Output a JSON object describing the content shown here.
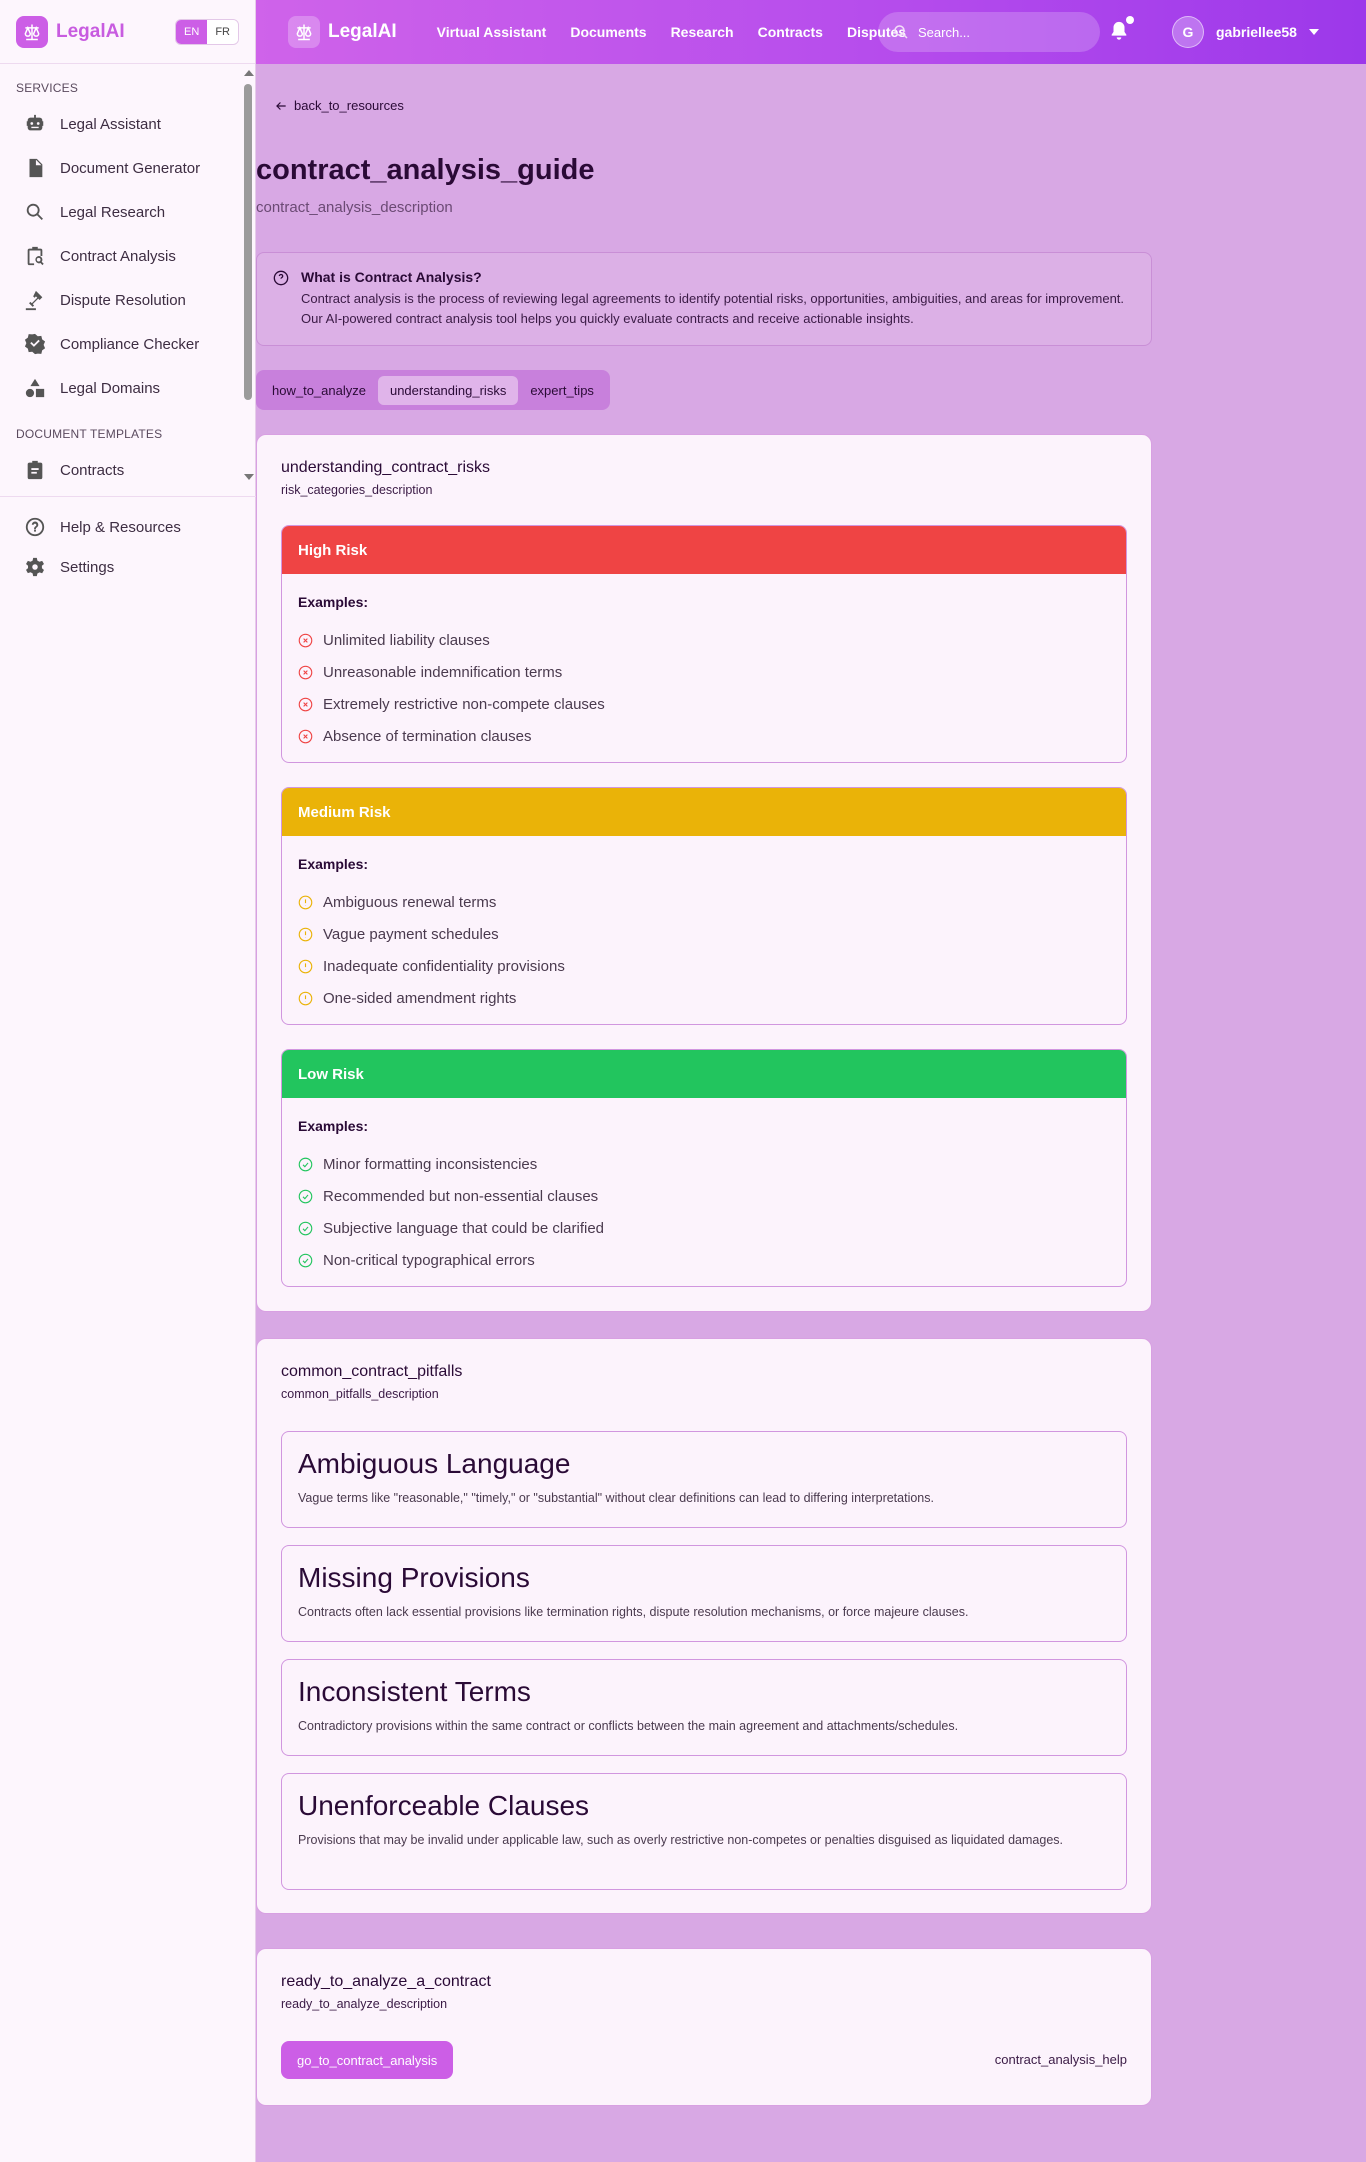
{
  "sidebar": {
    "brand": "LegalAI",
    "lang": {
      "en": "EN",
      "fr": "FR"
    },
    "services_title": "SERVICES",
    "services": [
      "Legal Assistant",
      "Document Generator",
      "Legal Research",
      "Contract Analysis",
      "Dispute Resolution",
      "Compliance Checker",
      "Legal Domains"
    ],
    "templates_title": "DOCUMENT TEMPLATES",
    "templates": [
      "Contracts"
    ],
    "bottom": [
      "Help & Resources",
      "Settings"
    ]
  },
  "topbar": {
    "brand": "LegalAI",
    "nav": [
      "Virtual Assistant",
      "Documents",
      "Research",
      "Contracts",
      "Disputes"
    ],
    "search_placeholder": "Search...",
    "user_initial": "G",
    "username": "gabriellee58"
  },
  "page": {
    "back": "back_to_resources",
    "title": "contract_analysis_guide",
    "subtitle": "contract_analysis_description",
    "info_title": "What is Contract Analysis?",
    "info_text": "Contract analysis is the process of reviewing legal agreements to identify potential risks, opportunities, ambiguities, and areas for improvement. Our AI-powered contract analysis tool helps you quickly evaluate contracts and receive actionable insights.",
    "tabs": [
      "how_to_analyze",
      "understanding_risks",
      "expert_tips"
    ],
    "active_tab": 1
  },
  "risks": {
    "title": "understanding_contract_risks",
    "desc": "risk_categories_description",
    "examples_label": "Examples:",
    "levels": [
      {
        "name": "High Risk",
        "color": "#ef4444",
        "icon": "x-circle-icon",
        "items": [
          "Unlimited liability clauses",
          "Unreasonable indemnification terms",
          "Extremely restrictive non-compete clauses",
          "Absence of termination clauses"
        ]
      },
      {
        "name": "Medium Risk",
        "color": "#eab308",
        "icon": "alert-circle-icon",
        "items": [
          "Ambiguous renewal terms",
          "Vague payment schedules",
          "Inadequate confidentiality provisions",
          "One-sided amendment rights"
        ]
      },
      {
        "name": "Low Risk",
        "color": "#22c55e",
        "icon": "check-circle-icon",
        "items": [
          "Minor formatting inconsistencies",
          "Recommended but non-essential clauses",
          "Subjective language that could be clarified",
          "Non-critical typographical errors"
        ]
      }
    ]
  },
  "pitfalls": {
    "title": "common_contract_pitfalls",
    "desc": "common_pitfalls_description",
    "items": [
      {
        "title": "Ambiguous Language",
        "text": "Vague terms like \"reasonable,\" \"timely,\" or \"substantial\" without clear definitions can lead to differing interpretations."
      },
      {
        "title": "Missing Provisions",
        "text": "Contracts often lack essential provisions like termination rights, dispute resolution mechanisms, or force majeure clauses."
      },
      {
        "title": "Inconsistent Terms",
        "text": "Contradictory provisions within the same contract or conflicts between the main agreement and attachments/schedules."
      },
      {
        "title": "Unenforceable Clauses",
        "text": "Provisions that may be invalid under applicable law, such as overly restrictive non-competes or penalties disguised as liquidated damages."
      }
    ]
  },
  "cta": {
    "title": "ready_to_analyze_a_contract",
    "desc": "ready_to_analyze_description",
    "button": "go_to_contract_analysis",
    "help": "contract_analysis_help"
  }
}
